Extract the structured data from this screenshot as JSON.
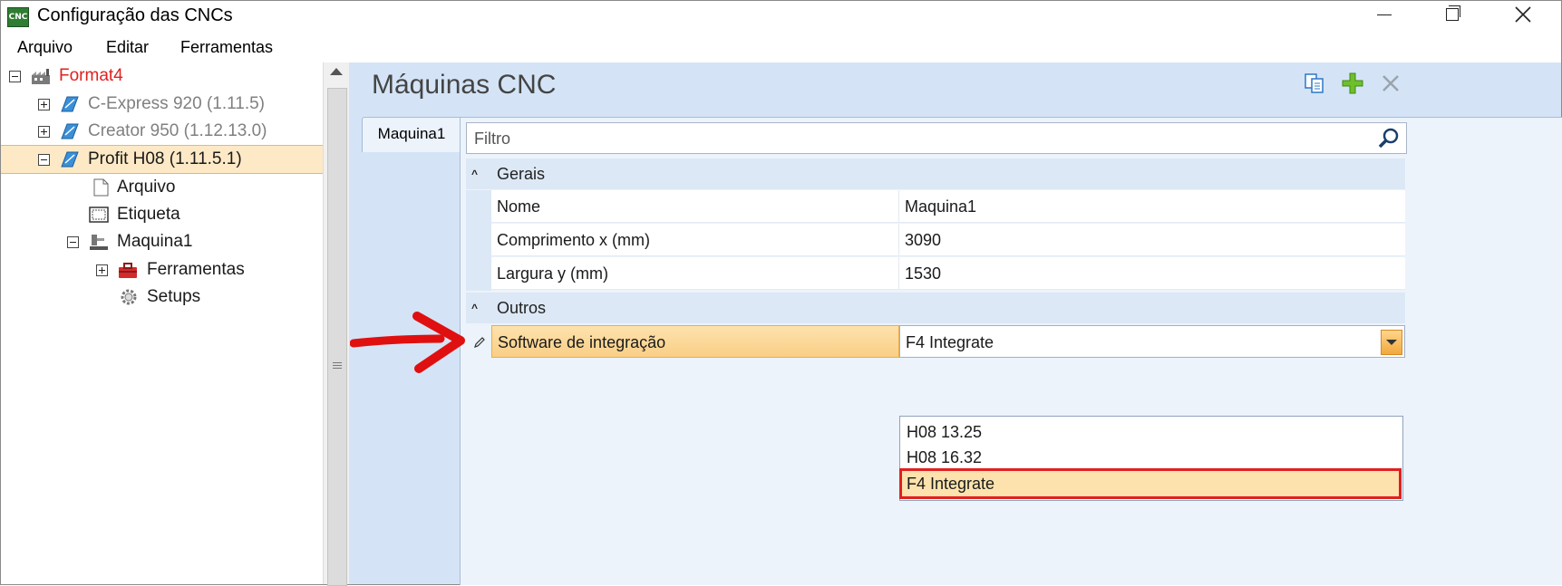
{
  "window": {
    "title": "Configuração das CNCs",
    "icon_text": "CNC",
    "controls": {
      "minimize": "minimize-icon",
      "maximize": "restore-icon",
      "close": "close-icon"
    }
  },
  "menu": [
    {
      "label": "Arquivo"
    },
    {
      "label": "Editar"
    },
    {
      "label": "Ferramentas"
    }
  ],
  "tree": {
    "root": {
      "label": "Format4",
      "icon": "factory-icon"
    },
    "items": [
      {
        "label": "C-Express 920 (1.11.5)",
        "icon": "cnc-machine-icon"
      },
      {
        "label": "Creator 950 (1.12.13.0)",
        "icon": "cnc-machine-icon"
      },
      {
        "label": "Profit H08 (1.11.5.1)",
        "icon": "cnc-machine-icon"
      },
      {
        "label": "Arquivo",
        "icon": "file-icon"
      },
      {
        "label": "Etiqueta",
        "icon": "label-icon"
      },
      {
        "label": "Maquina1",
        "icon": "machine-icon"
      },
      {
        "label": "Ferramentas",
        "icon": "toolbox-icon"
      },
      {
        "label": "Setups",
        "icon": "gear-icon"
      }
    ]
  },
  "panel": {
    "title": "Máquinas CNC",
    "toolbar": [
      "copy-icon",
      "add-icon",
      "delete-icon"
    ],
    "tab": "Maquina1",
    "filter_placeholder": "Filtro",
    "categories": [
      {
        "label": "Gerais"
      },
      {
        "label": "Outros"
      }
    ],
    "properties": [
      {
        "name": "Nome",
        "value": "Maquina1"
      },
      {
        "name": "Comprimento x (mm)",
        "value": "3090"
      },
      {
        "name": "Largura y (mm)",
        "value": "1530"
      },
      {
        "name": "Software de integração",
        "value": "F4 Integrate"
      }
    ],
    "dropdown_options": [
      "H08 13.25",
      "H08 16.32",
      "F4 Integrate"
    ],
    "selected_option": "F4 Integrate"
  },
  "colors": {
    "accent": "#fde2ad",
    "highlight_border": "#e02020",
    "panel_bg": "#d4e4f6",
    "root_label": "#e02020"
  }
}
